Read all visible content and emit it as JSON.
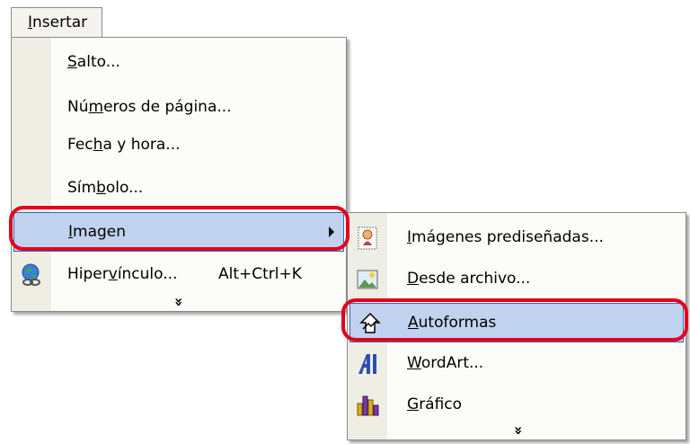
{
  "menubar": {
    "title_ul": "I",
    "title_rest": "nsertar"
  },
  "menu": {
    "items": [
      {
        "pre": "",
        "ul": "S",
        "post": "alto..."
      },
      {
        "pre": "Nú",
        "ul": "m",
        "post": "eros de página..."
      },
      {
        "pre": "Fec",
        "ul": "h",
        "post": "a y hora..."
      },
      {
        "pre": "Sím",
        "ul": "b",
        "post": "olo..."
      },
      {
        "pre": "",
        "ul": "I",
        "post": "magen",
        "submenu_arrow": true,
        "highlighted": true
      },
      {
        "pre": "Hiper",
        "ul": "v",
        "post": "ínculo...",
        "shortcut": "Alt+Ctrl+K",
        "icon": "globe-link-icon"
      }
    ],
    "expand_glyph": "»",
    "expand_icon": "expand-chevron-icon"
  },
  "submenu": {
    "items": [
      {
        "pre": "",
        "ul": "I",
        "post": "mágenes prediseñadas...",
        "icon": "clipart-icon"
      },
      {
        "pre": "",
        "ul": "D",
        "post": "esde archivo...",
        "icon": "picture-from-file-icon"
      },
      {
        "pre": "",
        "ul": "A",
        "post": "utoformas",
        "icon": "autoshapes-icon",
        "highlighted": true
      },
      {
        "pre": "",
        "ul": "W",
        "post": "ordArt...",
        "icon": "wordart-icon"
      },
      {
        "pre": "",
        "ul": "G",
        "post": "ráfico",
        "icon": "chart-icon"
      }
    ],
    "expand_glyph": "»"
  },
  "colors": {
    "highlight_bg": "#c1d2ee",
    "highlight_border": "#316ac5",
    "ring": "#e3001b",
    "gutter": "#efeee4"
  }
}
